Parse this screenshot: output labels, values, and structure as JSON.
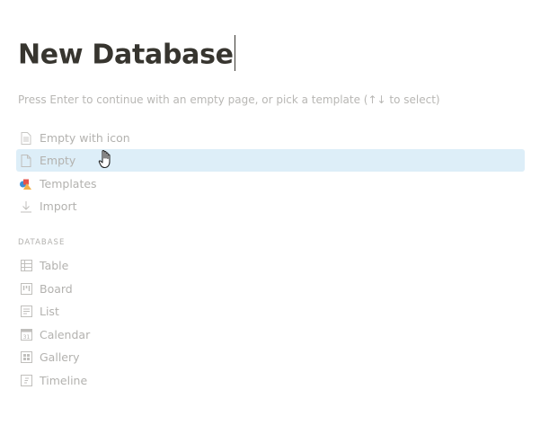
{
  "title": "New Database",
  "hint": "Press Enter to continue with an empty page, or pick a template (↑↓ to select)",
  "options": [
    {
      "label": "Empty with icon",
      "icon": "page-with-text-icon"
    },
    {
      "label": "Empty",
      "icon": "page-icon",
      "selected": true
    },
    {
      "label": "Templates",
      "icon": "templates-icon"
    },
    {
      "label": "Import",
      "icon": "download-icon"
    }
  ],
  "database_section": {
    "heading": "DATABASE",
    "items": [
      {
        "label": "Table",
        "icon": "table-icon"
      },
      {
        "label": "Board",
        "icon": "board-icon"
      },
      {
        "label": "List",
        "icon": "list-icon"
      },
      {
        "label": "Calendar",
        "icon": "calendar-icon",
        "icon_text": "31"
      },
      {
        "label": "Gallery",
        "icon": "gallery-icon"
      },
      {
        "label": "Timeline",
        "icon": "timeline-icon"
      }
    ]
  },
  "colors": {
    "title": "#37352f",
    "muted": "#b3b2af",
    "selection": "#ddeef8"
  }
}
